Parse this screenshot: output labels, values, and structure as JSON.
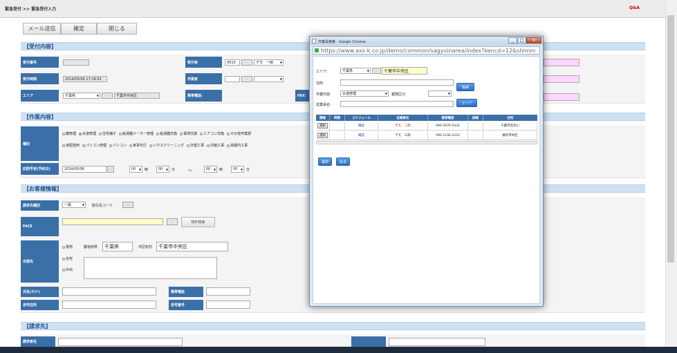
{
  "header": {
    "breadcrumb": "緊急受付 >> 緊急受付入力",
    "qa": "Q&A"
  },
  "toolbar": {
    "mail": "メール送信",
    "confirm": "確定",
    "close": "閉じる"
  },
  "sections": {
    "reception": "【受付内容】",
    "work": "【作業内容】",
    "customer": "【お客様情報】",
    "billing": "【請求先】"
  },
  "reception": {
    "receipt_no_label": "受付番号",
    "receiver_label": "受付者",
    "receiver_code": "0010",
    "receiver_name": "デモ　一郎",
    "time_label": "受付時間",
    "time_value": "2014/05/06 17:18:52",
    "worker_label": "作業者",
    "area_label": "エリア",
    "area_pref": "千葉県",
    "area_city": "千葉市中央区",
    "mobile_label": "携帯電話:",
    "fax_label": "FAX:"
  },
  "work": {
    "type_label": "種別",
    "types_row1": [
      "鍵修理",
      "水道修理",
      "住宅補子",
      "給湯器メーカー修理",
      "給湯器交換",
      "電球交換",
      "エアコン交換",
      "その他作業部"
    ],
    "types_row2": [
      "他配送命",
      "パソコン修理",
      "パソコン",
      "家事代行",
      "ハウスクリーニング",
      "外壁工事",
      "内装工事",
      "高層内工事"
    ],
    "selected_index": 1,
    "schedule_label": "訪問予定(予約日)",
    "schedule_date": "2014/05/06",
    "hour1": "00",
    "min1": "00",
    "hour2": "00",
    "min2": "00",
    "unit_hour": "時",
    "unit_min": "分",
    "tilde": "〜"
  },
  "customer": {
    "billing_type_label": "請求先種別",
    "billing_type_value": "一般",
    "client_code_label": "取引先コード",
    "face_label": "FACE",
    "property_search": "物件検索",
    "dest_label": "出張先",
    "opt_site": "現地",
    "opt_home": "自宅",
    "opt_other": "外出",
    "pref_label": "都道府県",
    "pref_value": "千葉県",
    "city_label": "市区町村",
    "city_value": "千葉市中央区",
    "name_kana_label": "氏名(カナ)",
    "mobile_label": "携帯電話",
    "home_phone_label": "自宅住所",
    "home_number_label": "自宅番号"
  },
  "billing": {
    "name_label": "請求者名"
  },
  "popup": {
    "window_title": "作業員検索 - Google Chrome",
    "url": "https://www.axs-k.co.jp/demo/common/sagyoinarea/index?kencd=12&shimm",
    "area_label": "エリア:",
    "area_pref": "千葉県",
    "area_city": "千葉市中央区",
    "address_label": "住所:",
    "work_label": "作業内容:",
    "work_value": "水道修理",
    "business_label": "業務区分:",
    "worker_name_label": "従業員名:",
    "search_btn": "検索",
    "clear_btn": "クリア",
    "table_headers": [
      "情報",
      "時間",
      "スケジュール",
      "従業員名",
      "携帯電話",
      "詳細",
      "住所"
    ],
    "rows": [
      {
        "pick": "選択",
        "time": "",
        "schedule": "確認",
        "name": "デモ　二郎",
        "phone": "090-5676-5432",
        "detail": "",
        "address": "千葉市花見川"
      },
      {
        "pick": "選択",
        "time": "",
        "schedule": "確認",
        "name": "デモ　三郎",
        "phone": "090-1234-2222",
        "detail": "",
        "address": "横浜市中区"
      }
    ],
    "select_btn": "選択",
    "back_btn": "戻る"
  },
  "colors": {
    "section_bg": "#cde1f3",
    "label_bg": "#3a6fa8",
    "highlight_yellow": "#ffffc8",
    "highlight_pink": "#ffd6ff"
  }
}
